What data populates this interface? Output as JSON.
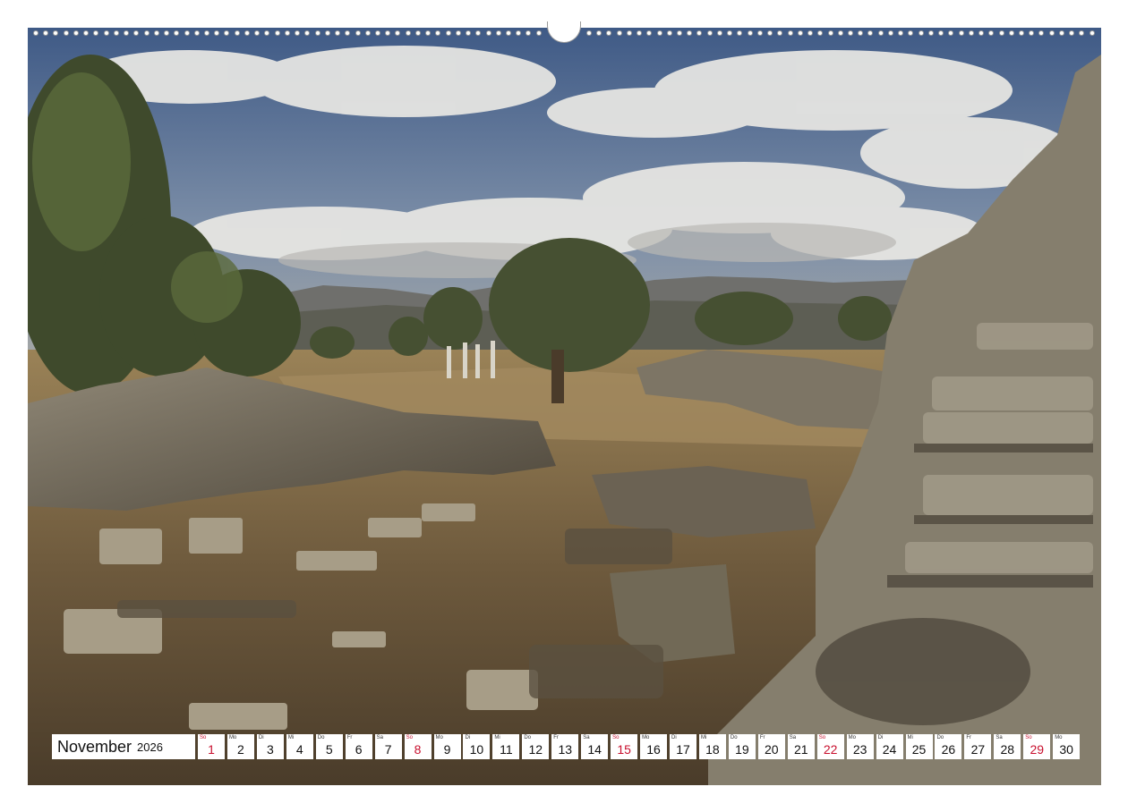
{
  "calendar": {
    "month": "November",
    "year": "2026",
    "days": [
      {
        "wd": "So",
        "n": "1",
        "sun": true
      },
      {
        "wd": "Mo",
        "n": "2"
      },
      {
        "wd": "Di",
        "n": "3"
      },
      {
        "wd": "Mi",
        "n": "4"
      },
      {
        "wd": "Do",
        "n": "5"
      },
      {
        "wd": "Fr",
        "n": "6"
      },
      {
        "wd": "Sa",
        "n": "7"
      },
      {
        "wd": "So",
        "n": "8",
        "sun": true
      },
      {
        "wd": "Mo",
        "n": "9"
      },
      {
        "wd": "Di",
        "n": "10"
      },
      {
        "wd": "Mi",
        "n": "11"
      },
      {
        "wd": "Do",
        "n": "12"
      },
      {
        "wd": "Fr",
        "n": "13"
      },
      {
        "wd": "Sa",
        "n": "14"
      },
      {
        "wd": "So",
        "n": "15",
        "sun": true
      },
      {
        "wd": "Mo",
        "n": "16"
      },
      {
        "wd": "Di",
        "n": "17"
      },
      {
        "wd": "Mi",
        "n": "18"
      },
      {
        "wd": "Do",
        "n": "19"
      },
      {
        "wd": "Fr",
        "n": "20"
      },
      {
        "wd": "Sa",
        "n": "21"
      },
      {
        "wd": "So",
        "n": "22",
        "sun": true
      },
      {
        "wd": "Mo",
        "n": "23"
      },
      {
        "wd": "Di",
        "n": "24"
      },
      {
        "wd": "Mi",
        "n": "25"
      },
      {
        "wd": "Do",
        "n": "26"
      },
      {
        "wd": "Fr",
        "n": "27"
      },
      {
        "wd": "Sa",
        "n": "28"
      },
      {
        "wd": "So",
        "n": "29",
        "sun": true
      },
      {
        "wd": "Mo",
        "n": "30"
      }
    ]
  },
  "colors": {
    "sunday": "#c8102e",
    "text": "#111111"
  },
  "icons": {
    "binding": "spiral-binding-holes",
    "hanger": "hanger-notch"
  }
}
